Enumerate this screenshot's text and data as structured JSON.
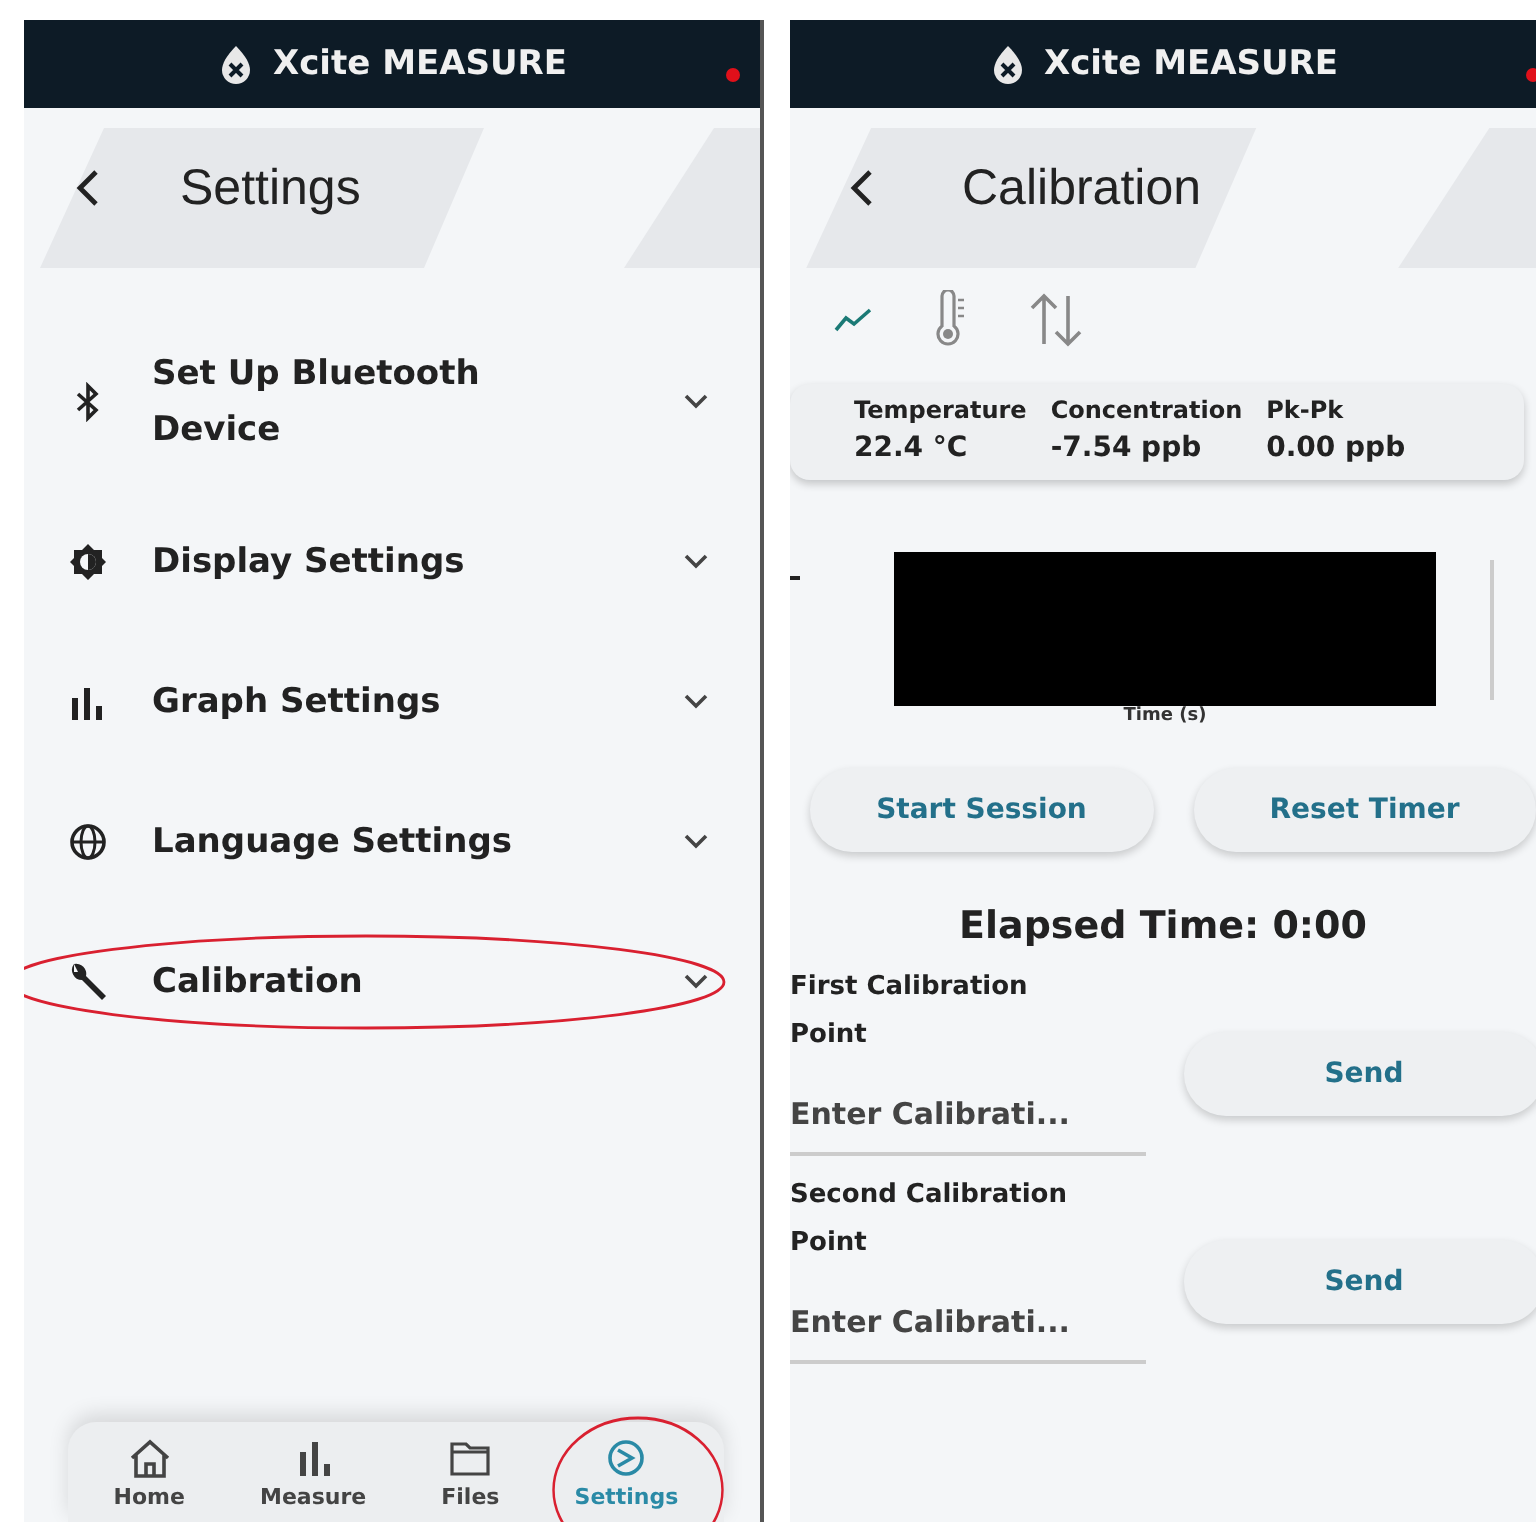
{
  "settings_screen": {
    "app_title": "Xcite MEASURE",
    "page_title": "Settings",
    "menu": [
      {
        "kind": "bluetooth",
        "label": "Set Up Bluetooth Device",
        "annotated": false
      },
      {
        "kind": "display",
        "label": "Display Settings",
        "annotated": false
      },
      {
        "kind": "graph",
        "label": "Graph Settings",
        "annotated": false
      },
      {
        "kind": "language",
        "label": "Language Settings",
        "annotated": false
      },
      {
        "kind": "wrench",
        "label": "Calibration",
        "annotated": true
      }
    ],
    "nav": [
      {
        "kind": "home",
        "label": "Home",
        "selected": false,
        "annotated": false
      },
      {
        "kind": "measure",
        "label": "Measure",
        "selected": false,
        "annotated": false
      },
      {
        "kind": "files",
        "label": "Files",
        "selected": false,
        "annotated": false
      },
      {
        "kind": "settings",
        "label": "Settings",
        "selected": true,
        "annotated": true
      }
    ]
  },
  "calibration_screen": {
    "app_title": "Xcite MEASURE",
    "page_title": "Calibration",
    "view_tabs": [
      {
        "kind": "trend",
        "selected": true
      },
      {
        "kind": "thermometer",
        "selected": false
      },
      {
        "kind": "swap",
        "selected": false
      }
    ],
    "metrics": [
      {
        "label": "Temperature",
        "value": "22.4 °C"
      },
      {
        "label": "Concentration",
        "value": "-7.54 ppb"
      },
      {
        "label": "Pk-Pk",
        "value": "0.00 ppb"
      }
    ],
    "chart": {
      "xlabel": "Time (s)",
      "redacted": true
    },
    "buttons": [
      "Start Session",
      "Reset Timer"
    ],
    "elapsed": "Elapsed Time: 0:00",
    "points": [
      {
        "label": "First Calibration Point",
        "placeholder": "Enter Calibrati...",
        "button": "Send"
      },
      {
        "label": "Second Calibration Point",
        "placeholder": "Enter Calibrati...",
        "button": "Send"
      }
    ]
  }
}
